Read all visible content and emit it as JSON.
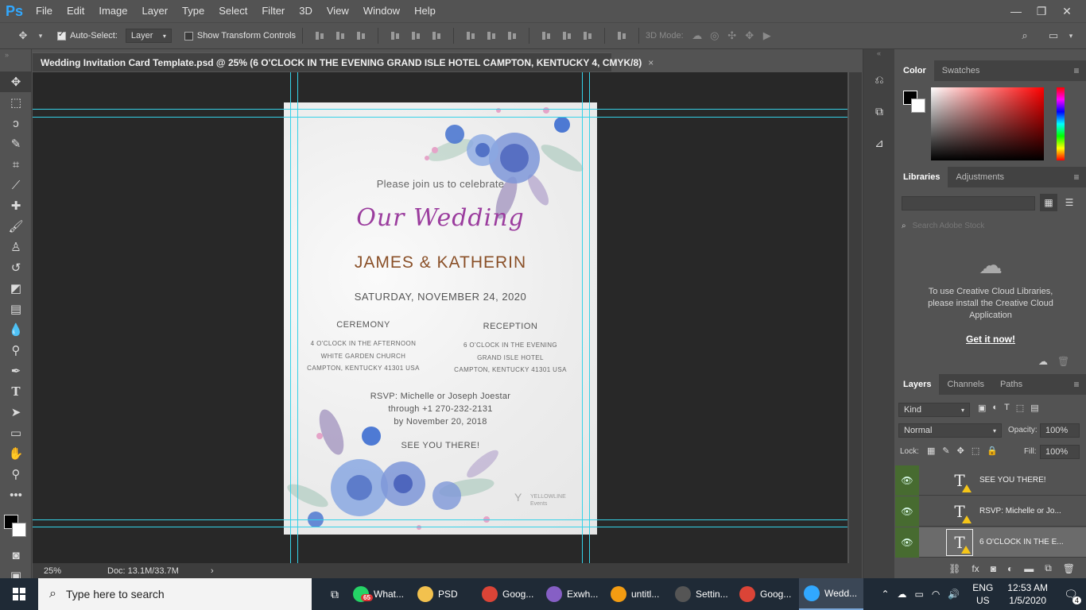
{
  "app": {
    "logo": "Ps",
    "window_buttons": [
      "—",
      "❐",
      "✕"
    ]
  },
  "menu": [
    "File",
    "Edit",
    "Image",
    "Layer",
    "Type",
    "Select",
    "Filter",
    "3D",
    "View",
    "Window",
    "Help"
  ],
  "options": {
    "auto_select_label": "Auto-Select:",
    "auto_select_value": "Layer",
    "transform_label": "Show Transform Controls",
    "mode_3d_label": "3D Mode:"
  },
  "document": {
    "tab_title": "Wedding Invitation Card Template.psd @ 25% (6 O'CLOCK IN THE EVENING  GRAND ISLE HOTEL  CAMPTON, KENTUCKY 4, CMYK/8)",
    "close": "×",
    "zoom": "25%",
    "doc_size": "Doc: 13.1M/33.7M"
  },
  "card": {
    "invite": "Please join us to celebrate",
    "title": "Our Wedding",
    "names": "JAMES & KATHERIN",
    "date": "SATURDAY, NOVEMBER 24, 2020",
    "ceremony": {
      "heading": "CEREMONY",
      "line1": "4 O'CLOCK IN THE AFTERNOON",
      "line2": "WHITE GARDEN  CHURCH",
      "line3": "CAMPTON, KENTUCKY 41301 USA"
    },
    "reception": {
      "heading": "RECEPTION",
      "line1": "6 O'CLOCK IN THE EVENING",
      "line2": "GRAND ISLE HOTEL",
      "line3": "CAMPTON, KENTUCKY 41301 USA"
    },
    "rsvp1": "RSVP: Michelle or Joseph Joestar",
    "rsvp2": "through +1 270-232-2131",
    "rsvp3": "by November 20, 2018",
    "see_you": "SEE YOU THERE!",
    "brand_mark": "Y",
    "brand_name": "YELLOWLINE",
    "brand_sub": "Events"
  },
  "panels": {
    "color_tabs": [
      "Color",
      "Swatches"
    ],
    "library_tabs": [
      "Libraries",
      "Adjustments"
    ],
    "library_search_placeholder": "Search Adobe Stock",
    "library_message": "To use Creative Cloud Libraries, please install the Creative Cloud Application",
    "library_link": "Get it now!",
    "layer_tabs": [
      "Layers",
      "Channels",
      "Paths"
    ],
    "kind_label": "Kind",
    "blend_mode": "Normal",
    "opacity_label": "Opacity:",
    "opacity_value": "100%",
    "lock_label": "Lock:",
    "fill_label": "Fill:",
    "fill_value": "100%",
    "layers": [
      "SEE YOU THERE!",
      "RSVP: Michelle or Jo...",
      "6 O'CLOCK IN THE E..."
    ]
  },
  "taskbar": {
    "search_placeholder": "Type here to search",
    "items": [
      {
        "label": "What...",
        "color": "#25d366",
        "badge": "65"
      },
      {
        "label": "PSD",
        "color": "#f2c14e"
      },
      {
        "label": "Goog...",
        "color": "#db4437"
      },
      {
        "label": "Exwh...",
        "color": "#865fc5"
      },
      {
        "label": "untitl...",
        "color": "#f39c12"
      },
      {
        "label": "Settin...",
        "color": "#555555"
      },
      {
        "label": "Goog...",
        "color": "#db4437"
      },
      {
        "label": "Wedd...",
        "color": "#31a8ff",
        "active": true
      }
    ],
    "lang1": "ENG",
    "lang2": "US",
    "time": "12:53 AM",
    "date": "1/5/2020",
    "notifications": "4"
  }
}
